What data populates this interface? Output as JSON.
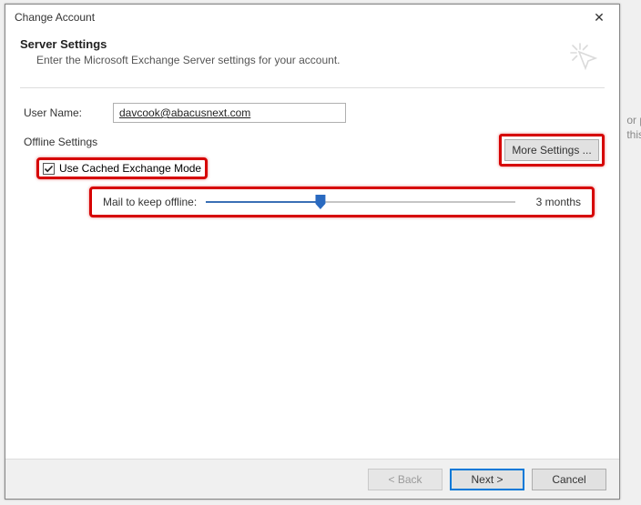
{
  "window": {
    "title": "Change Account"
  },
  "header": {
    "title": "Server Settings",
    "subtitle": "Enter the Microsoft Exchange Server settings for your account."
  },
  "user": {
    "label": "User Name:",
    "value": "davcook@abacusnext.com"
  },
  "offline": {
    "section_label": "Offline Settings",
    "cached_label": "Use Cached Exchange Mode",
    "cached_checked": true,
    "slider_label": "Mail to keep offline:",
    "slider_value": "3 months"
  },
  "buttons": {
    "more": "More Settings ...",
    "back": "< Back",
    "next": "Next >",
    "cancel": "Cancel"
  },
  "bg": {
    "line1": "or p",
    "line2": "this"
  }
}
